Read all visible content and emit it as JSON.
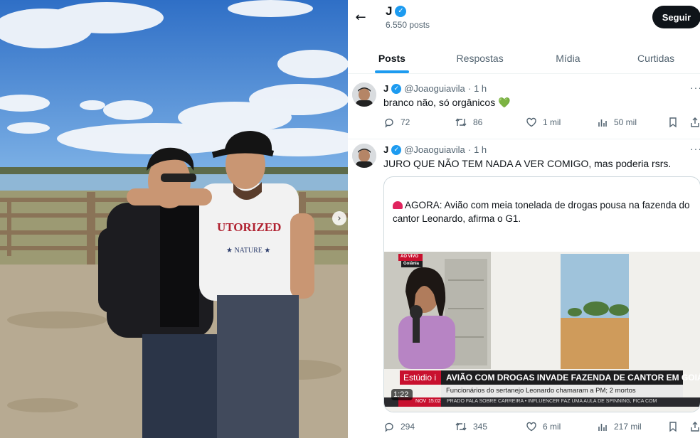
{
  "header": {
    "name": "J",
    "post_count": "6.550 posts",
    "follow_label": "Seguir"
  },
  "tabs": [
    {
      "label": "Posts",
      "active": true
    },
    {
      "label": "Respostas",
      "active": false
    },
    {
      "label": "Mídia",
      "active": false
    },
    {
      "label": "Curtidas",
      "active": false
    }
  ],
  "tweets": [
    {
      "name": "J",
      "handle": "@Joaoguiavila",
      "separator": "·",
      "time": "1 h",
      "text": "branco não, só orgânicos 💚",
      "replies": "72",
      "retweets": "86",
      "likes": "1 mil",
      "views": "50 mil"
    },
    {
      "name": "J",
      "handle": "@Joaoguiavila",
      "separator": "·",
      "time": "1 h",
      "text": "JURO QUE NÃO TEM NADA A VER COMIGO, mas poderia rsrs.",
      "replies": "294",
      "retweets": "345",
      "likes": "6 mil",
      "views": "217 mil"
    }
  ],
  "quoted": {
    "text": "AGORA: Avião com meia tonelada de drogas pousa na fazenda do cantor Leonardo, afirma o G1.",
    "news": {
      "live_badge": "AO VIVO",
      "location": "Goiânia",
      "program": "Estúdio i",
      "headline": "AVIÃO COM DROGAS INVADE FAZENDA DE CANTOR EM GOIÁS",
      "subheadline": "Funcionários do sertanejo Leonardo chamaram a PM; 2 mortos",
      "duration": "1:22",
      "ticker_left": "NOV",
      "ticker_time": "15:02",
      "ticker": "PRADO FALA SOBRE CARREIRA  •  INFLUENCER FAZ UMA AULA DE SPINNING, FICA COM"
    }
  },
  "icons": {
    "back": "back-arrow-icon",
    "verified": "verified-badge-icon",
    "reply": "reply-icon",
    "retweet": "retweet-icon",
    "like": "heart-icon",
    "views": "views-icon",
    "bookmark": "bookmark-icon",
    "share": "share-icon",
    "carousel_next": "chevron-right-icon"
  },
  "colors": {
    "accent": "#1d9bf0",
    "text": "#0f1419",
    "muted": "#536471",
    "news_red": "#c8102e"
  }
}
